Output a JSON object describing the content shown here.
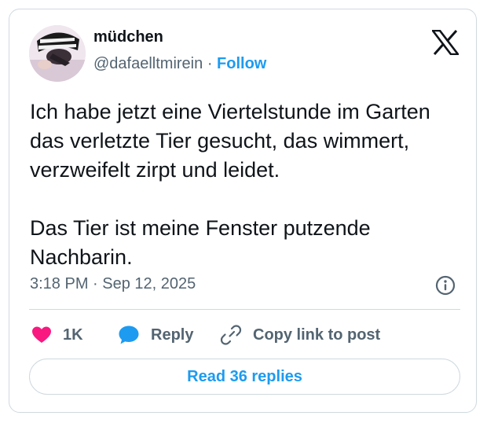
{
  "author": {
    "display_name": "müdchen",
    "handle": "@dafaelltmirein",
    "separator": "·",
    "follow_label": "Follow",
    "avatar_icon": "profile-photo-avatar"
  },
  "platform": {
    "logo_icon": "x-logo-icon"
  },
  "post": {
    "paragraphs": [
      "Ich habe jetzt eine Viertelstunde im Garten das verletzte Tier gesucht, das wimmert, verzweifelt zirpt und leidet.",
      "Das Tier ist meine Fenster putzende Nachbarin."
    ],
    "timestamp": "3:18 PM · Sep 12, 2025"
  },
  "actions": {
    "like_count": "1K",
    "reply_label": "Reply",
    "copy_link_label": "Copy link to post",
    "read_replies_label": "Read 36 replies"
  },
  "colors": {
    "heart": "#f91880",
    "reply_bubble": "#1d9bf0",
    "link_blue": "#1d9bf0",
    "secondary_text": "#536471",
    "primary_text": "#0f1419",
    "border": "#cfd9de"
  }
}
